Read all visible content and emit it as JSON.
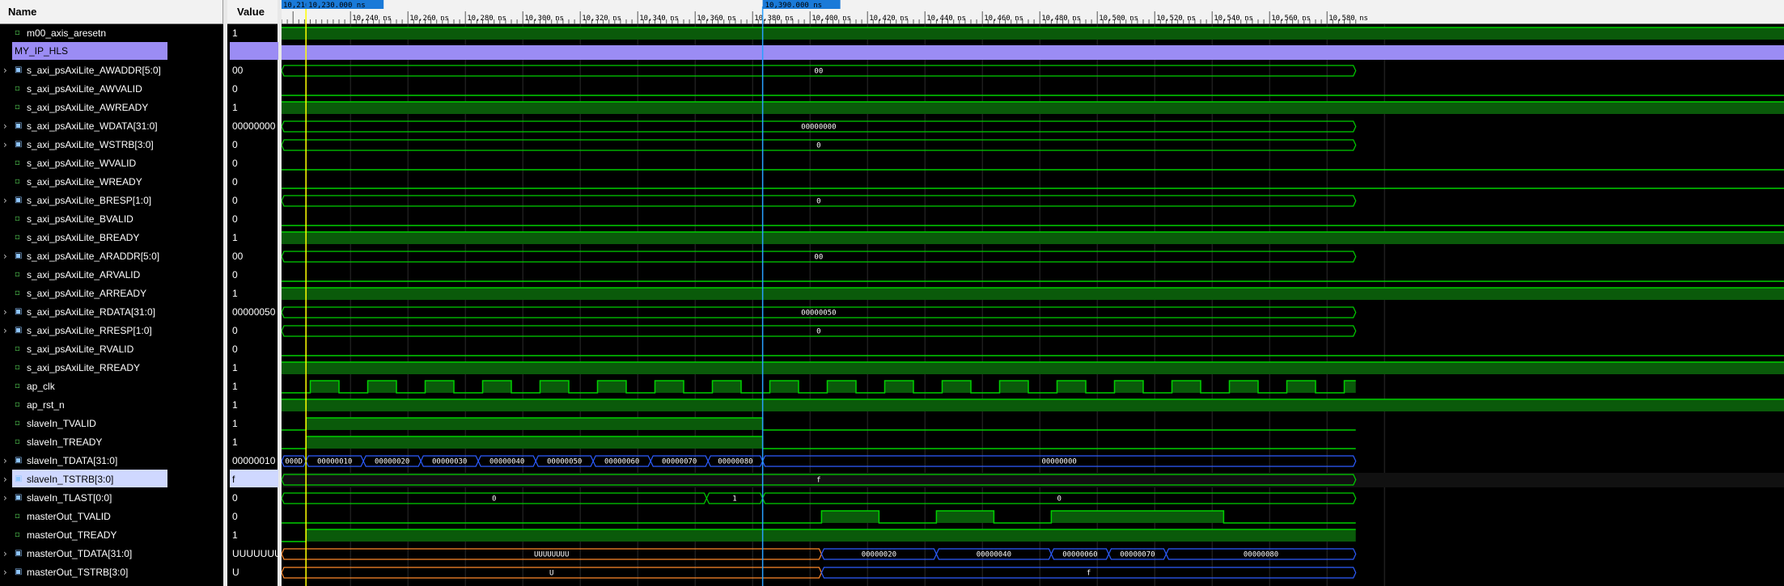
{
  "headers": {
    "name": "Name",
    "value": "Value"
  },
  "cursors": {
    "primary": "10,230.000 ns",
    "secondary": "10,390.000 ns",
    "left_edge": "10,216"
  },
  "time_ticks": [
    "10,240 ns",
    "10,260 ns",
    "10,280 ns",
    "10,300 ns",
    "10,320 ns",
    "10,340 ns",
    "10,360 ns",
    "10,380 ns",
    "10,400 ns",
    "10,420 ns",
    "10,440 ns",
    "10,460 ns",
    "10,480 ns",
    "10,500 ns",
    "10,520 ns",
    "10,540 ns",
    "10,560 ns",
    "10,580 ns"
  ],
  "colors": {
    "signal_green": "#00d000",
    "high_fill": "#0a5a0a",
    "bus_blue": "#2c5cff",
    "bus_undef": "#ff8a2a",
    "group_purple": "#9b8cf4",
    "cursor_yellow": "#ffff00",
    "cursor_blue": "#28a0ff"
  },
  "signals": [
    {
      "name": "m00_axis_aresetn",
      "value": "1",
      "kind": "bit",
      "icon": "bit-signal-icon",
      "expand": false
    },
    {
      "name": "MY_IP_HLS",
      "value": "",
      "kind": "group",
      "icon": "",
      "expand": false
    },
    {
      "name": "s_axi_psAxiLite_AWADDR[5:0]",
      "value": "00",
      "kind": "bus",
      "icon": "bus-signal-icon",
      "expand": true
    },
    {
      "name": "s_axi_psAxiLite_AWVALID",
      "value": "0",
      "kind": "bit",
      "icon": "bit-signal-icon",
      "expand": false
    },
    {
      "name": "s_axi_psAxiLite_AWREADY",
      "value": "1",
      "kind": "bit",
      "icon": "bit-signal-icon",
      "expand": false
    },
    {
      "name": "s_axi_psAxiLite_WDATA[31:0]",
      "value": "00000000",
      "kind": "bus",
      "icon": "bus-signal-icon",
      "expand": true
    },
    {
      "name": "s_axi_psAxiLite_WSTRB[3:0]",
      "value": "0",
      "kind": "bus",
      "icon": "bus-signal-icon",
      "expand": true
    },
    {
      "name": "s_axi_psAxiLite_WVALID",
      "value": "0",
      "kind": "bit",
      "icon": "bit-signal-icon",
      "expand": false
    },
    {
      "name": "s_axi_psAxiLite_WREADY",
      "value": "0",
      "kind": "bit",
      "icon": "bit-signal-icon",
      "expand": false
    },
    {
      "name": "s_axi_psAxiLite_BRESP[1:0]",
      "value": "0",
      "kind": "bus",
      "icon": "bus-signal-icon",
      "expand": true
    },
    {
      "name": "s_axi_psAxiLite_BVALID",
      "value": "0",
      "kind": "bit",
      "icon": "bit-signal-icon",
      "expand": false
    },
    {
      "name": "s_axi_psAxiLite_BREADY",
      "value": "1",
      "kind": "bit",
      "icon": "bit-signal-icon",
      "expand": false
    },
    {
      "name": "s_axi_psAxiLite_ARADDR[5:0]",
      "value": "00",
      "kind": "bus",
      "icon": "bus-signal-icon",
      "expand": true
    },
    {
      "name": "s_axi_psAxiLite_ARVALID",
      "value": "0",
      "kind": "bit",
      "icon": "bit-signal-icon",
      "expand": false
    },
    {
      "name": "s_axi_psAxiLite_ARREADY",
      "value": "1",
      "kind": "bit",
      "icon": "bit-signal-icon",
      "expand": false
    },
    {
      "name": "s_axi_psAxiLite_RDATA[31:0]",
      "value": "00000050",
      "kind": "bus",
      "icon": "bus-signal-icon",
      "expand": true
    },
    {
      "name": "s_axi_psAxiLite_RRESP[1:0]",
      "value": "0",
      "kind": "bus",
      "icon": "bus-signal-icon",
      "expand": true
    },
    {
      "name": "s_axi_psAxiLite_RVALID",
      "value": "0",
      "kind": "bit",
      "icon": "bit-signal-icon",
      "expand": false
    },
    {
      "name": "s_axi_psAxiLite_RREADY",
      "value": "1",
      "kind": "bit",
      "icon": "bit-signal-icon",
      "expand": false
    },
    {
      "name": "ap_clk",
      "value": "1",
      "kind": "bit",
      "icon": "bit-signal-icon",
      "expand": false
    },
    {
      "name": "ap_rst_n",
      "value": "1",
      "kind": "bit",
      "icon": "bit-signal-icon",
      "expand": false
    },
    {
      "name": "slaveIn_TVALID",
      "value": "1",
      "kind": "bit",
      "icon": "bit-signal-icon",
      "expand": false
    },
    {
      "name": "slaveIn_TREADY",
      "value": "1",
      "kind": "bit",
      "icon": "bit-signal-icon",
      "expand": false
    },
    {
      "name": "slaveIn_TDATA[31:0]",
      "value": "00000010",
      "kind": "bus",
      "icon": "bus-signal-icon",
      "expand": true
    },
    {
      "name": "slaveIn_TSTRB[3:0]",
      "value": "f",
      "kind": "bus",
      "icon": "bus-signal-icon",
      "expand": true,
      "selected": true
    },
    {
      "name": "slaveIn_TLAST[0:0]",
      "value": "0",
      "kind": "bus",
      "icon": "bus-signal-icon",
      "expand": true
    },
    {
      "name": "masterOut_TVALID",
      "value": "0",
      "kind": "bit",
      "icon": "bit-signal-icon",
      "expand": false
    },
    {
      "name": "masterOut_TREADY",
      "value": "1",
      "kind": "bit",
      "icon": "bit-signal-icon",
      "expand": false
    },
    {
      "name": "masterOut_TDATA[31:0]",
      "value": "UUUUUUUU",
      "kind": "bus",
      "icon": "bus-signal-icon",
      "expand": true
    },
    {
      "name": "masterOut_TSTRB[3:0]",
      "value": "U",
      "kind": "bus",
      "icon": "bus-signal-icon",
      "expand": true
    }
  ],
  "bus_labels": {
    "awaddr": "00",
    "wdata": "00000000",
    "wstrb": "0",
    "bresp": "0",
    "araddr": "00",
    "rdata": "00000050",
    "rresp": "0",
    "tdata_in": [
      "000D",
      "00000010",
      "00000020",
      "00000030",
      "00000040",
      "00000050",
      "00000060",
      "00000070",
      "00000080",
      "00000000"
    ],
    "tstrb_in": "f",
    "tlast": [
      "0",
      "1",
      "0"
    ],
    "tdata_out": [
      "UUUUUUUU",
      "00000020",
      "00000040",
      "00000060",
      "00000070",
      "00000080"
    ],
    "tstrb_out": [
      "U",
      "f"
    ]
  }
}
